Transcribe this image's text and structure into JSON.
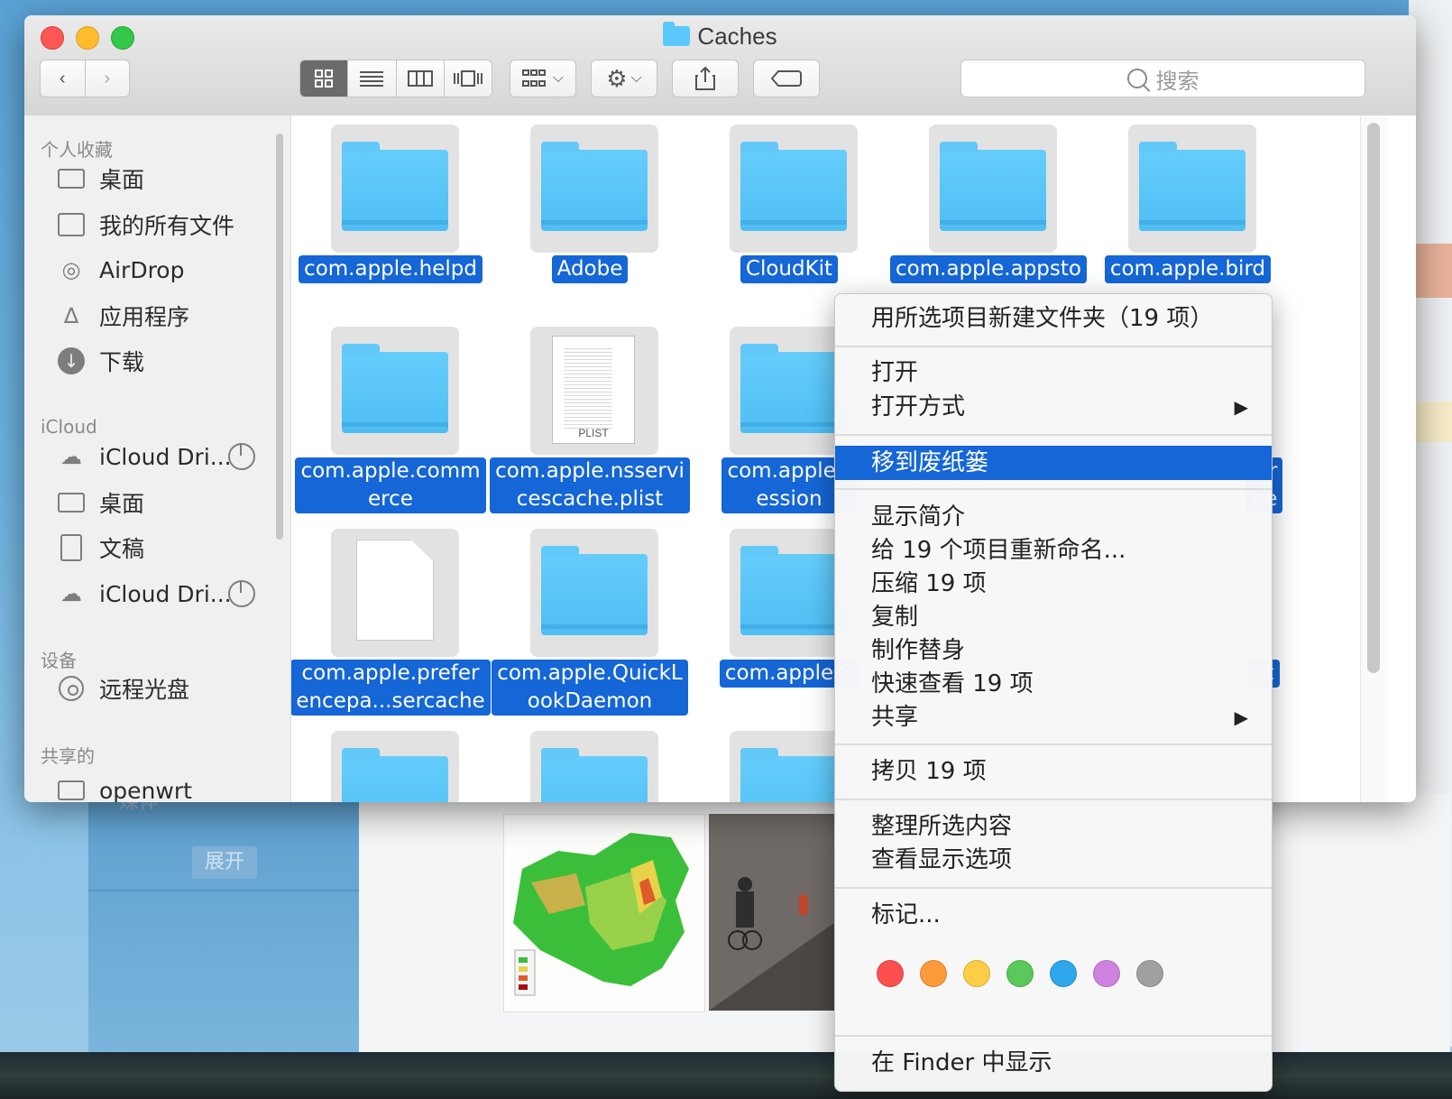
{
  "background": {
    "media_label": "媒体",
    "expand_label": "展开"
  },
  "window": {
    "title": "Caches"
  },
  "toolbar": {
    "search_placeholder": "搜索"
  },
  "sidebar": {
    "favorites_header": "个人收藏",
    "favorites": [
      {
        "label": "桌面"
      },
      {
        "label": "我的所有文件"
      },
      {
        "label": "AirDrop"
      },
      {
        "label": "应用程序"
      },
      {
        "label": "下载"
      }
    ],
    "icloud_header": "iCloud",
    "icloud": [
      {
        "label": "iCloud Dri..."
      },
      {
        "label": "桌面"
      },
      {
        "label": "文稿"
      },
      {
        "label": "iCloud Dri..."
      }
    ],
    "devices_header": "设备",
    "devices": [
      {
        "label": "远程光盘"
      }
    ],
    "shared_header": "共享的",
    "shared": [
      {
        "label": "openwrt"
      }
    ]
  },
  "files": [
    {
      "name": "com.apple.helpd",
      "kind": "folder"
    },
    {
      "name": "Adobe",
      "kind": "folder"
    },
    {
      "name": "CloudKit",
      "kind": "folder"
    },
    {
      "name": "com.apple.appsto",
      "kind": "folder"
    },
    {
      "name": "com.apple.bird",
      "kind": "folder"
    },
    {
      "name": "com.apple.comm\nerce",
      "kind": "folder"
    },
    {
      "name": "com.apple.nsservi\ncescache.plist",
      "kind": "plist",
      "badge": "PLIST"
    },
    {
      "name": "com.apple.r\nession",
      "kind": "folder"
    },
    {
      "name": "er\nne",
      "kind": "hidden"
    },
    {
      "name": "com.apple.prefer\nencepa...sercache",
      "kind": "blank"
    },
    {
      "name": "com.apple.QuickL\nookDaemon",
      "kind": "folder"
    },
    {
      "name": "com.apple.S",
      "kind": "folder"
    },
    {
      "name": "st",
      "kind": "hidden"
    }
  ],
  "context_menu": {
    "items": [
      {
        "label": "用所选项目新建文件夹（19 项）"
      },
      {
        "label": "打开"
      },
      {
        "label": "打开方式",
        "submenu": true
      },
      {
        "label": "移到废纸篓",
        "highlighted": true
      },
      {
        "label": "显示简介"
      },
      {
        "label": "给 19 个项目重新命名..."
      },
      {
        "label": "压缩 19 项"
      },
      {
        "label": "复制"
      },
      {
        "label": "制作替身"
      },
      {
        "label": "快速查看 19 项"
      },
      {
        "label": "共享",
        "submenu": true
      },
      {
        "label": "拷贝 19 项"
      },
      {
        "label": "整理所选内容"
      },
      {
        "label": "查看显示选项"
      },
      {
        "label": "标记..."
      },
      {
        "label": "在 Finder 中显示"
      }
    ],
    "tag_colors": [
      "#fc4f4f",
      "#fd9a3a",
      "#fdcd45",
      "#5ac85a",
      "#2ea8ea",
      "#cf82e0",
      "#a0a0a0"
    ]
  }
}
